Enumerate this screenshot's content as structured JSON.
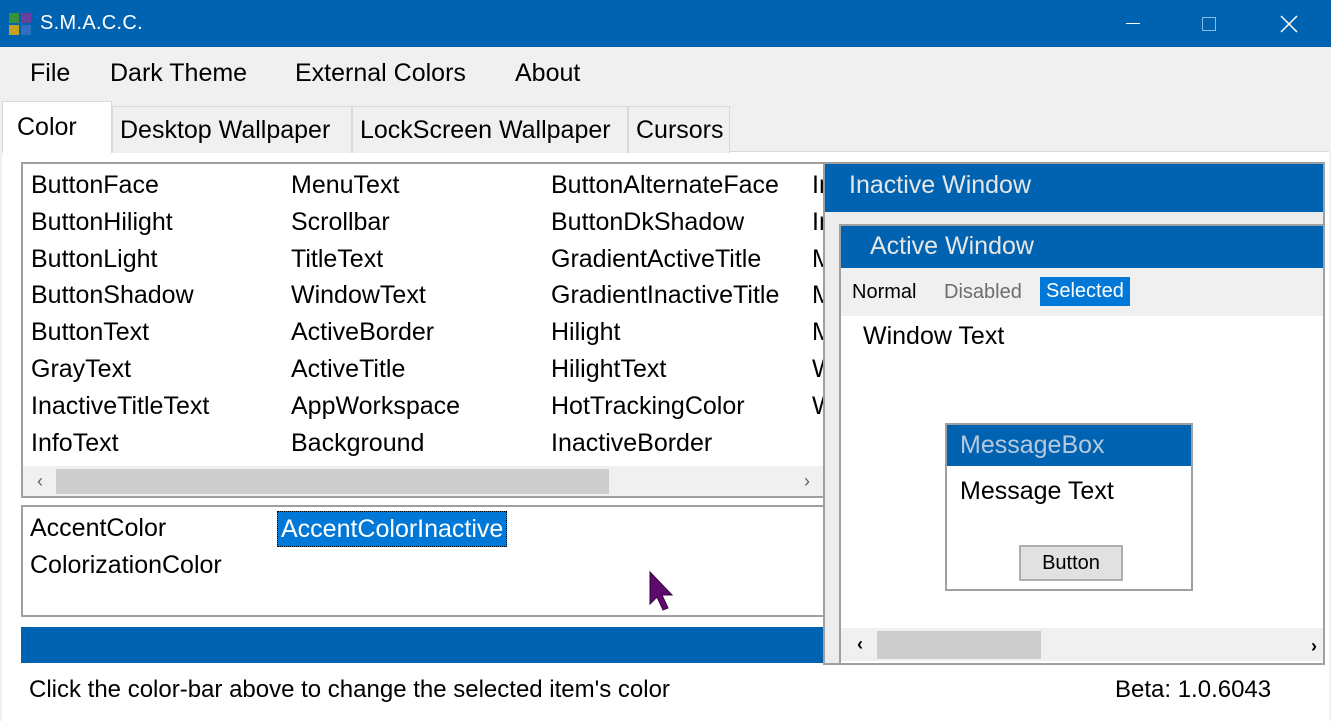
{
  "window": {
    "title": "S.M.A.C.C.",
    "accent_color": "#0063b1"
  },
  "menu": [
    "File",
    "Dark Theme",
    "External Colors",
    "About"
  ],
  "tabs": [
    {
      "label": "Color",
      "active": true
    },
    {
      "label": "Desktop Wallpaper",
      "active": false
    },
    {
      "label": "LockScreen Wallpaper",
      "active": false
    },
    {
      "label": "Cursors",
      "active": false
    }
  ],
  "system_colors": {
    "columns": [
      [
        "ButtonFace",
        "ButtonHilight",
        "ButtonLight",
        "ButtonShadow",
        "ButtonText",
        "GrayText",
        "InactiveTitleText",
        "InfoText"
      ],
      [
        "MenuText",
        "Scrollbar",
        "TitleText",
        "WindowText",
        "ActiveBorder",
        "ActiveTitle",
        "AppWorkspace",
        "Background"
      ],
      [
        "ButtonAlternateFace",
        "ButtonDkShadow",
        "GradientActiveTitle",
        "GradientInactiveTitle",
        "Hilight",
        "HilightText",
        "HotTrackingColor",
        "InactiveBorder"
      ],
      [
        "In",
        "In",
        "M",
        "M",
        "M",
        "W",
        "W",
        ""
      ]
    ]
  },
  "accent_colors": {
    "items": [
      "AccentColor",
      "AccentColorInactive",
      "ColorizationColor"
    ],
    "selected": "AccentColorInactive"
  },
  "color_bar": {
    "color": "#0063b1"
  },
  "status": {
    "hint": "Click the color-bar above to change the selected item's color",
    "version": "Beta: 1.0.6043"
  },
  "preview": {
    "inactive_window_title": "Inactive Window",
    "active_window_title": "Active Window",
    "menu_normal": "Normal",
    "menu_disabled": "Disabled",
    "menu_selected": "Selected",
    "window_text": "Window Text",
    "messagebox_title": "MessageBox",
    "message_text": "Message Text",
    "button_label": "Button"
  }
}
